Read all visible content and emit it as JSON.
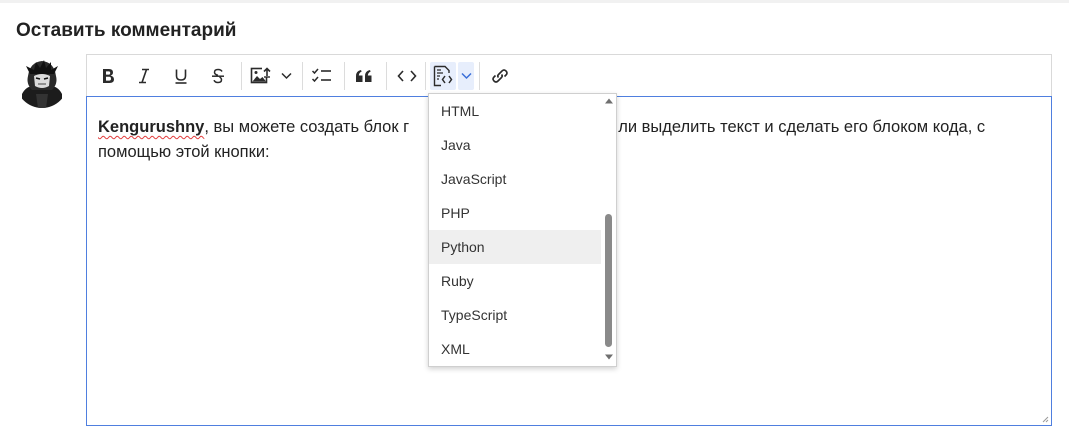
{
  "page": {
    "heading": "Оставить комментарий"
  },
  "toolbar": {
    "buttons": [
      {
        "name": "bold-button",
        "icon": "bold-icon",
        "glyph": "B"
      },
      {
        "name": "italic-button",
        "icon": "italic-icon",
        "glyph": "I"
      },
      {
        "name": "underline-button",
        "icon": "underline-icon",
        "glyph": "U"
      },
      {
        "name": "strikethrough-button",
        "icon": "strikethrough-icon",
        "glyph": "S"
      },
      {
        "name": "insert-image-button",
        "icon": "image-upload-icon"
      },
      {
        "name": "image-options-dropdown",
        "icon": "chevron-down-icon"
      },
      {
        "name": "todo-list-button",
        "icon": "checklist-icon"
      },
      {
        "name": "blockquote-button",
        "icon": "quote-icon"
      },
      {
        "name": "inline-code-button",
        "icon": "code-icon"
      },
      {
        "name": "code-block-button",
        "icon": "code-block-icon"
      },
      {
        "name": "code-language-dropdown",
        "icon": "chevron-down-icon"
      },
      {
        "name": "link-button",
        "icon": "link-icon"
      }
    ]
  },
  "editor": {
    "mention": "Kengurushny",
    "text_before_dropdown": ", вы можете создать блок г",
    "text_after_dropdown": "ли выделить текст и сделать его блоком кода, с",
    "line2": "помощью этой кнопки:"
  },
  "dropdown": {
    "items": [
      "HTML",
      "Java",
      "JavaScript",
      "PHP",
      "Python",
      "Ruby",
      "TypeScript",
      "XML"
    ],
    "hovered": "Python"
  },
  "colors": {
    "accent": "#4f7fdf",
    "active_button_bg": "#e7eefc",
    "hover_item_bg": "#efefef",
    "spellcheck_underline": "#e23b3b"
  }
}
